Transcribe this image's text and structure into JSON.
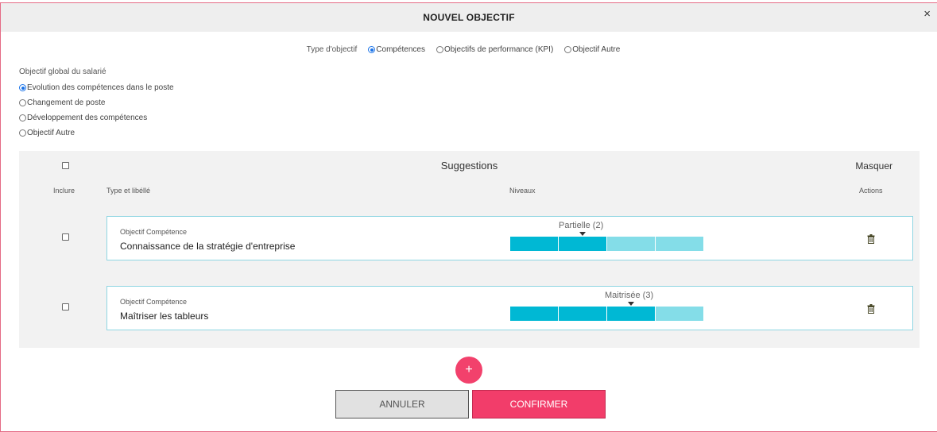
{
  "modal": {
    "title": "NOUVEL OBJECTIF",
    "close_icon": "×"
  },
  "objective_type": {
    "label": "Type d'objectif",
    "options": [
      {
        "label": "Compétences",
        "selected": true
      },
      {
        "label": "Objectifs de performance (KPI)",
        "selected": false
      },
      {
        "label": "Objectif Autre",
        "selected": false
      }
    ]
  },
  "global_objective": {
    "label": "Objectif global du salarié",
    "options": [
      {
        "label": "Evolution des compétences dans le poste",
        "selected": true
      },
      {
        "label": "Changement de poste",
        "selected": false
      },
      {
        "label": "Développement des compétences",
        "selected": false
      },
      {
        "label": "Objectif Autre",
        "selected": false
      }
    ]
  },
  "suggestions": {
    "title": "Suggestions",
    "hide_label": "Masquer",
    "columns": {
      "include": "Inclure",
      "type_label": "Type et libéllé",
      "levels": "Niveaux",
      "actions": "Actions"
    },
    "items": [
      {
        "type": "Objectif Compétence",
        "label": "Connaissance de la stratégie d'entreprise",
        "level_label": "Partielle (2)",
        "level": 2,
        "max_level": 4,
        "included": false
      },
      {
        "type": "Objectif Compétence",
        "label": "Maîtriser les tableurs",
        "level_label": "Maitrisée (3)",
        "level": 3,
        "max_level": 4,
        "included": false
      }
    ]
  },
  "footer": {
    "add_label": "+",
    "cancel_label": "ANNULER",
    "confirm_label": "CONFIRMER"
  },
  "colors": {
    "accent": "#f23d6a",
    "level_full": "#00b8d4",
    "level_empty": "#84dde8",
    "radio_selected": "#1a73e8"
  },
  "icons": {
    "close": "close-icon",
    "trash": "trash-icon",
    "add": "plus-icon",
    "caret": "caret-down-icon"
  }
}
